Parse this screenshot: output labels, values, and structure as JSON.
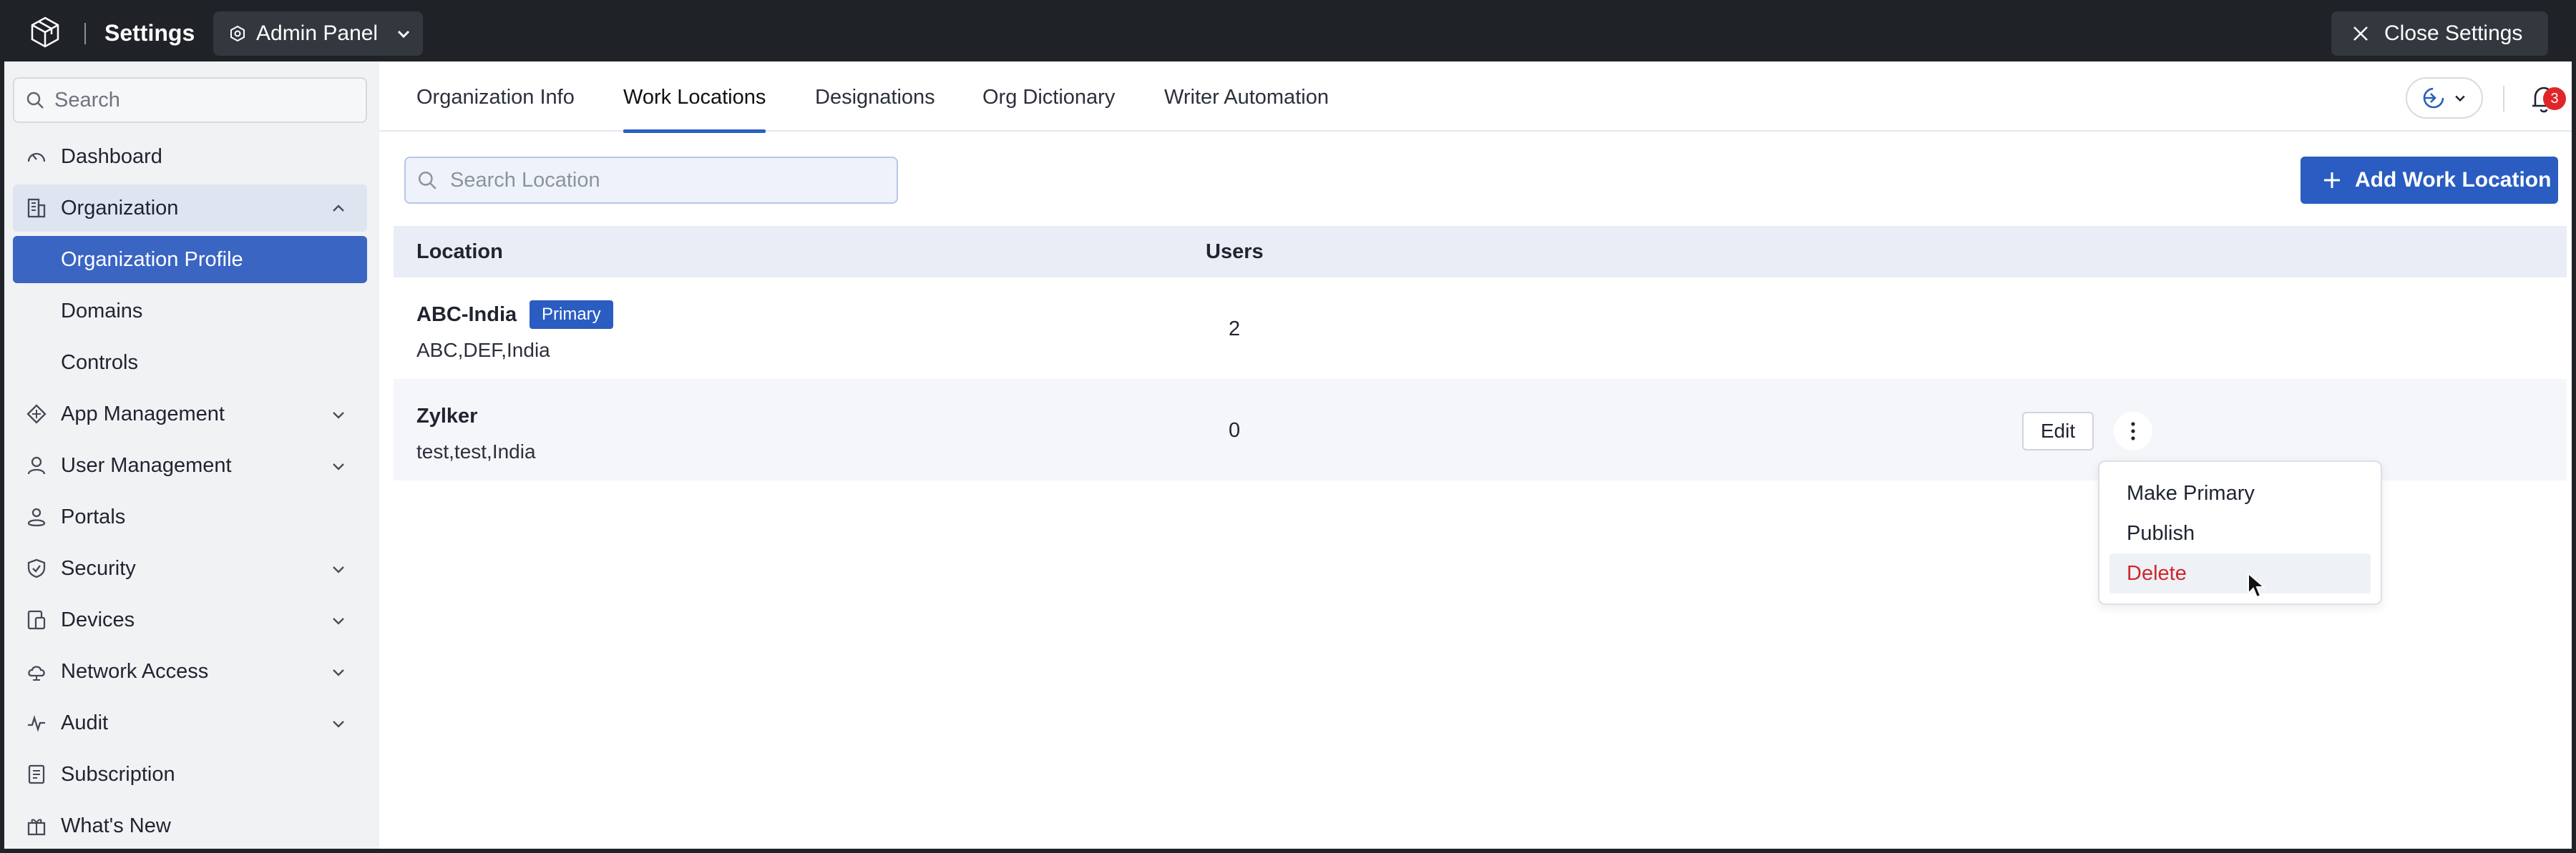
{
  "topbar": {
    "title": "Settings",
    "panel_switch": "Admin Panel",
    "close_label": "Close Settings"
  },
  "sidebar": {
    "search_placeholder": "Search",
    "items": [
      {
        "label": "Dashboard",
        "icon": "gauge-icon"
      },
      {
        "label": "Organization",
        "icon": "building-icon",
        "expanded": true
      },
      {
        "label": "Organization Profile",
        "active": true
      },
      {
        "label": "Domains"
      },
      {
        "label": "Controls"
      },
      {
        "label": "App Management",
        "icon": "apps-icon"
      },
      {
        "label": "User Management",
        "icon": "user-icon"
      },
      {
        "label": "Portals",
        "icon": "portal-icon"
      },
      {
        "label": "Security",
        "icon": "shield-icon"
      },
      {
        "label": "Devices",
        "icon": "devices-icon"
      },
      {
        "label": "Network Access",
        "icon": "cloud-icon"
      },
      {
        "label": "Audit",
        "icon": "pulse-icon"
      },
      {
        "label": "Subscription",
        "icon": "receipt-icon"
      },
      {
        "label": "What's New",
        "icon": "gift-icon"
      }
    ]
  },
  "tabs": [
    {
      "label": "Organization Info"
    },
    {
      "label": "Work Locations",
      "active": true
    },
    {
      "label": "Designations"
    },
    {
      "label": "Org Dictionary"
    },
    {
      "label": "Writer Automation"
    }
  ],
  "notifications": {
    "count": "3"
  },
  "locations": {
    "search_placeholder": "Search Location",
    "add_label": "Add Work Location",
    "columns": [
      "Location",
      "Users"
    ],
    "rows": [
      {
        "name": "ABC-India",
        "badge": "Primary",
        "address": "ABC,DEF,India",
        "users": "2"
      },
      {
        "name": "Zylker",
        "address": "test,test,India",
        "users": "0",
        "edit_label": "Edit"
      }
    ]
  },
  "row_menu": {
    "items": [
      "Make Primary",
      "Publish",
      "Delete"
    ]
  },
  "colors": {
    "accent": "#2a5cc1",
    "danger": "#d0262d",
    "topbar": "#1f2327"
  }
}
